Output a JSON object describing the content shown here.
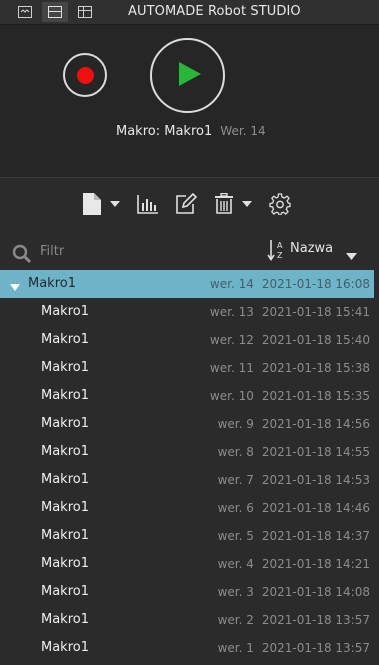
{
  "window": {
    "title": "AUTOMADE Robot STUDIO",
    "layout_buttons": [
      "layout-compact-icon",
      "layout-split-icon",
      "layout-grid-icon"
    ]
  },
  "player": {
    "record_icon": "record-icon",
    "play_icon": "play-icon",
    "macro_label": "Makro: Makro1",
    "version_label": "Wer. 14",
    "colors": {
      "record": "#ee0f0f",
      "play": "#27b83a"
    }
  },
  "toolbar": {
    "icons": [
      "new-file-icon",
      "chart-icon",
      "edit-icon",
      "trash-icon",
      "settings-icon"
    ]
  },
  "filter": {
    "placeholder": "Filtr",
    "value": "",
    "sort_label": "Nazwa"
  },
  "list": {
    "selected_color": "#6fb3c8",
    "parent": {
      "name": "Makro1",
      "version": "wer. 14",
      "date": "2021-01-18 16:08"
    },
    "versions": [
      {
        "name": "Makro1",
        "version": "wer. 13",
        "date": "2021-01-18 15:41"
      },
      {
        "name": "Makro1",
        "version": "wer. 12",
        "date": "2021-01-18 15:40"
      },
      {
        "name": "Makro1",
        "version": "wer. 11",
        "date": "2021-01-18 15:38"
      },
      {
        "name": "Makro1",
        "version": "wer. 10",
        "date": "2021-01-18 15:35"
      },
      {
        "name": "Makro1",
        "version": "wer. 9",
        "date": "2021-01-18 14:56"
      },
      {
        "name": "Makro1",
        "version": "wer. 8",
        "date": "2021-01-18 14:55"
      },
      {
        "name": "Makro1",
        "version": "wer. 7",
        "date": "2021-01-18 14:53"
      },
      {
        "name": "Makro1",
        "version": "wer. 6",
        "date": "2021-01-18 14:46"
      },
      {
        "name": "Makro1",
        "version": "wer. 5",
        "date": "2021-01-18 14:37"
      },
      {
        "name": "Makro1",
        "version": "wer. 4",
        "date": "2021-01-18 14:21"
      },
      {
        "name": "Makro1",
        "version": "wer. 3",
        "date": "2021-01-18 14:08"
      },
      {
        "name": "Makro1",
        "version": "wer. 2",
        "date": "2021-01-18 13:57"
      },
      {
        "name": "Makro1",
        "version": "wer. 1",
        "date": "2021-01-18 13:57"
      }
    ]
  }
}
